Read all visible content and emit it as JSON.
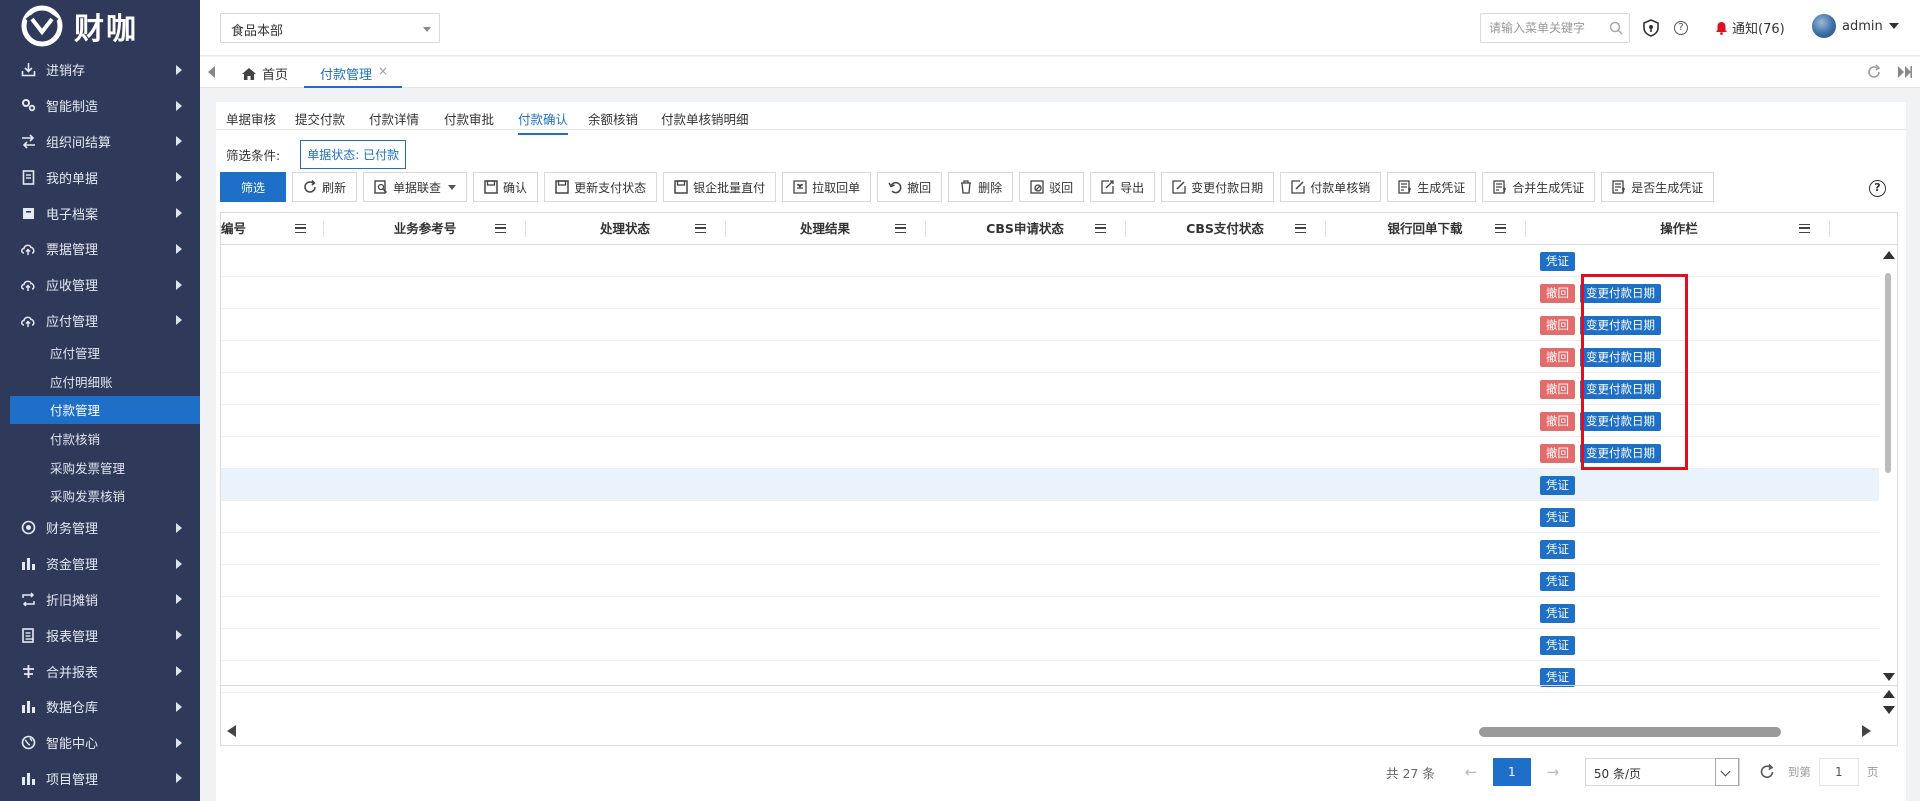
{
  "brand": {
    "logo_text": "财咖"
  },
  "sidebar": {
    "items": [
      {
        "label": "进销存",
        "icon": "download-icon"
      },
      {
        "label": "智能制造",
        "icon": "gears-icon"
      },
      {
        "label": "组织间结算",
        "icon": "exchange-icon"
      },
      {
        "label": "我的单据",
        "icon": "document-icon"
      },
      {
        "label": "电子档案",
        "icon": "archive-icon"
      },
      {
        "label": "票据管理",
        "icon": "cloud-upload-icon"
      },
      {
        "label": "应收管理",
        "icon": "cloud-upload-icon"
      },
      {
        "label": "应付管理",
        "icon": "cloud-upload-icon"
      }
    ],
    "sub_items": [
      {
        "label": "应付管理",
        "active": false
      },
      {
        "label": "应付明细账",
        "active": false
      },
      {
        "label": "付款管理",
        "active": true
      },
      {
        "label": "付款核销",
        "active": false
      },
      {
        "label": "采购发票管理",
        "active": false
      },
      {
        "label": "采购发票核销",
        "active": false
      }
    ],
    "items_after": [
      {
        "label": "财务管理",
        "icon": "target-icon"
      },
      {
        "label": "资金管理",
        "icon": "bar-chart-icon"
      },
      {
        "label": "折旧摊销",
        "icon": "loop-icon"
      },
      {
        "label": "报表管理",
        "icon": "report-icon"
      },
      {
        "label": "合并报表",
        "icon": "tree-icon"
      },
      {
        "label": "数据仓库",
        "icon": "bar-chart-icon"
      },
      {
        "label": "智能中心",
        "icon": "globe-icon"
      },
      {
        "label": "项目管理",
        "icon": "bar-chart-icon"
      }
    ]
  },
  "header": {
    "org_select": "食品本部",
    "search_placeholder": "请输入菜单关键字",
    "notice_label": "通知(76)",
    "user_name": "admin"
  },
  "tabs": {
    "home": "首页",
    "current": "付款管理",
    "close": "×"
  },
  "subtabs": [
    "单据审核",
    "提交付款",
    "付款详情",
    "付款审批",
    "付款确认",
    "余额核销",
    "付款单核销明细"
  ],
  "subtab_active_index": 4,
  "filter": {
    "label": "筛选条件:",
    "chip": "单据状态: 已付款"
  },
  "toolbar": {
    "buttons": [
      {
        "label": "筛选",
        "icon": ""
      },
      {
        "label": "刷新",
        "icon": "refresh-icon"
      },
      {
        "label": "单据联查",
        "icon": "search-doc-icon"
      },
      {
        "label": "确认",
        "icon": "save-icon"
      },
      {
        "label": "更新支付状态",
        "icon": "save-icon"
      },
      {
        "label": "银企批量直付",
        "icon": "save-icon"
      },
      {
        "label": "拉取回单",
        "icon": "receipt-icon"
      },
      {
        "label": "撤回",
        "icon": "undo-icon"
      },
      {
        "label": "删除",
        "icon": "trash-icon"
      },
      {
        "label": "驳回",
        "icon": "reject-icon"
      },
      {
        "label": "导出",
        "icon": "export-icon"
      },
      {
        "label": "变更付款日期",
        "icon": "edit-icon"
      },
      {
        "label": "付款单核销",
        "icon": "edit-icon"
      },
      {
        "label": "生成凭证",
        "icon": "voucher-icon"
      },
      {
        "label": "合并生成凭证",
        "icon": "voucher-icon"
      },
      {
        "label": "是否生成凭证",
        "icon": "voucher-icon"
      }
    ],
    "help": "?"
  },
  "grid": {
    "columns": [
      "编号",
      "业务参考号",
      "处理状态",
      "处理结果",
      "CBS申请状态",
      "CBS支付状态",
      "银行回单下载",
      "操作栏"
    ],
    "rows": [
      {
        "ops": [
          "凭证"
        ]
      },
      {
        "ops": [
          "撤回",
          "变更付款日期"
        ]
      },
      {
        "ops": [
          "撤回",
          "变更付款日期"
        ]
      },
      {
        "ops": [
          "撤回",
          "变更付款日期"
        ]
      },
      {
        "ops": [
          "撤回",
          "变更付款日期"
        ]
      },
      {
        "ops": [
          "撤回",
          "变更付款日期"
        ]
      },
      {
        "ops": [
          "撤回",
          "变更付款日期"
        ]
      },
      {
        "ops": [
          "凭证"
        ],
        "highlight": true
      },
      {
        "ops": [
          "凭证"
        ]
      },
      {
        "ops": [
          "凭证"
        ]
      },
      {
        "ops": [
          "凭证"
        ]
      },
      {
        "ops": [
          "凭证"
        ]
      },
      {
        "ops": [
          "凭证"
        ]
      },
      {
        "ops": [
          "凭证"
        ]
      }
    ]
  },
  "pager": {
    "total": "共 27 条",
    "prev": "←",
    "current_page": "1",
    "next": "→",
    "page_size": "50 条/页",
    "goto_label": "到第",
    "goto_value": "1",
    "page_suffix": "页"
  },
  "colors": {
    "sidebar_bg": "#2f3a5a",
    "primary": "#1d6fc8",
    "danger": "#e46b6b",
    "highlight_box": "#e0111f"
  }
}
